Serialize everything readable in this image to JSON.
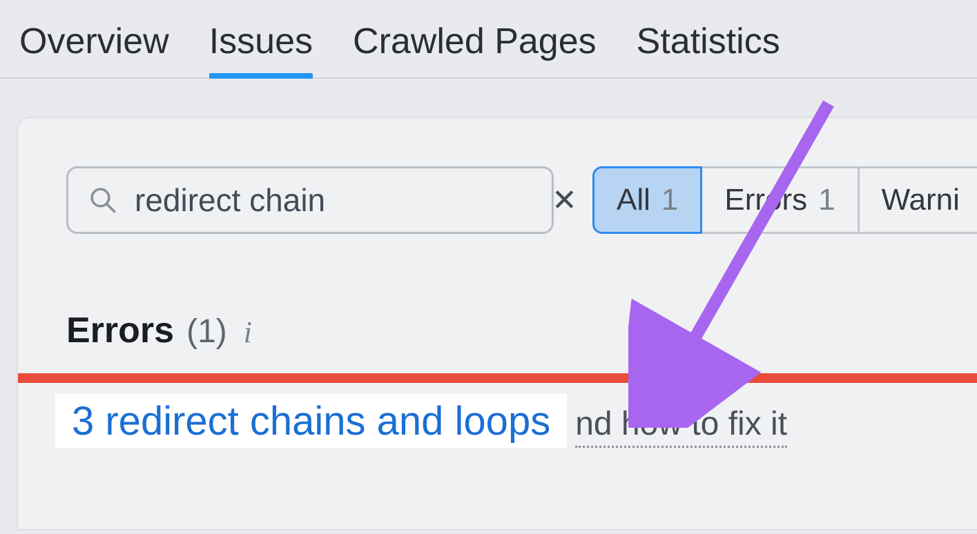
{
  "tabs": {
    "overview": "Overview",
    "issues": "Issues",
    "crawled": "Crawled Pages",
    "statistics": "Statistics"
  },
  "search": {
    "value": "redirect chain"
  },
  "filters": {
    "all": {
      "label": "All",
      "count": "1"
    },
    "errors": {
      "label": "Errors",
      "count": "1"
    },
    "warnings": {
      "label": "Warni"
    }
  },
  "section": {
    "title": "Errors",
    "count": "(1)"
  },
  "issue": {
    "link": "3 redirect chains and loops",
    "hint": "nd how to fix it"
  }
}
